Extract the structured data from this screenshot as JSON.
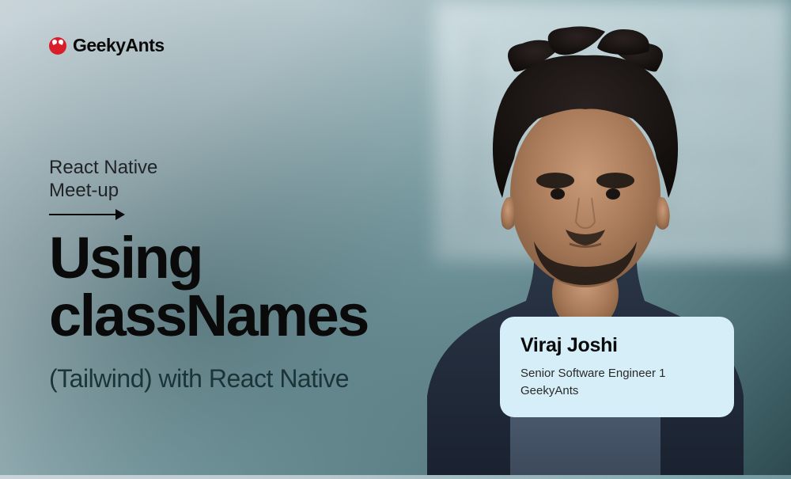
{
  "logo": {
    "text": "GeekyAnts"
  },
  "eyebrow": {
    "line1": "React Native",
    "line2": "Meet-up"
  },
  "headline": {
    "line1": "Using",
    "line2": "classNames"
  },
  "subhead": "(Tailwind) with React Native",
  "speaker": {
    "name": "Viraj Joshi",
    "role_line1": "Senior Software Engineer 1",
    "role_line2": "GeekyAnts"
  },
  "colors": {
    "brand_red": "#d91e2a",
    "card_bg": "#d6eef7"
  }
}
